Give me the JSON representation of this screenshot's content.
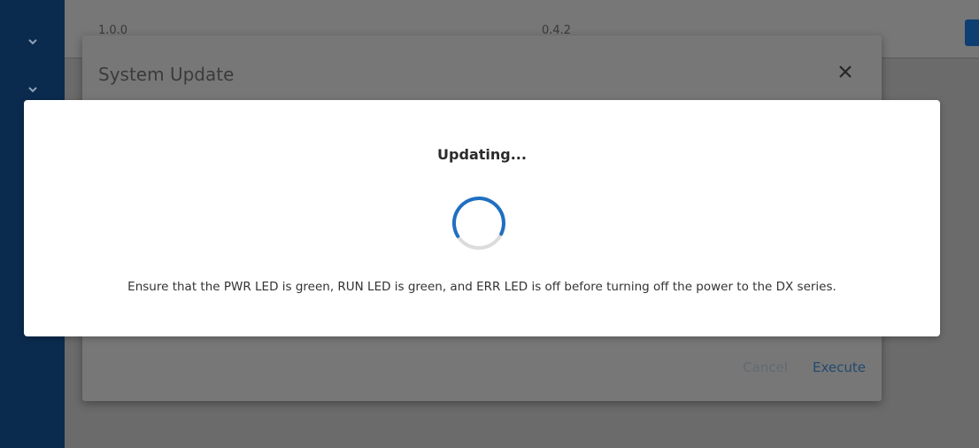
{
  "background": {
    "version_left": "1.0.0",
    "version_right": "0.4.2"
  },
  "system_update_dialog": {
    "title": "System Update",
    "cancel_label": "Cancel",
    "execute_label": "Execute"
  },
  "update_modal": {
    "title": "Updating...",
    "message": "Ensure that the PWR LED is green, RUN LED is green, and ERR LED is off before turning off the power to the DX series."
  },
  "icons": {
    "sidebar_expand_1": "chevron-down-icon",
    "sidebar_expand_2": "chevron-down-icon",
    "close": "close-icon",
    "spinner": "loading-spinner-icon"
  },
  "colors": {
    "sidebar": "#0b2b4e",
    "overlay": "#6b6b6b",
    "spinner_arc": "#1f6fc2",
    "spinner_track": "#dcdcdc",
    "execute_text": "#23496f"
  }
}
